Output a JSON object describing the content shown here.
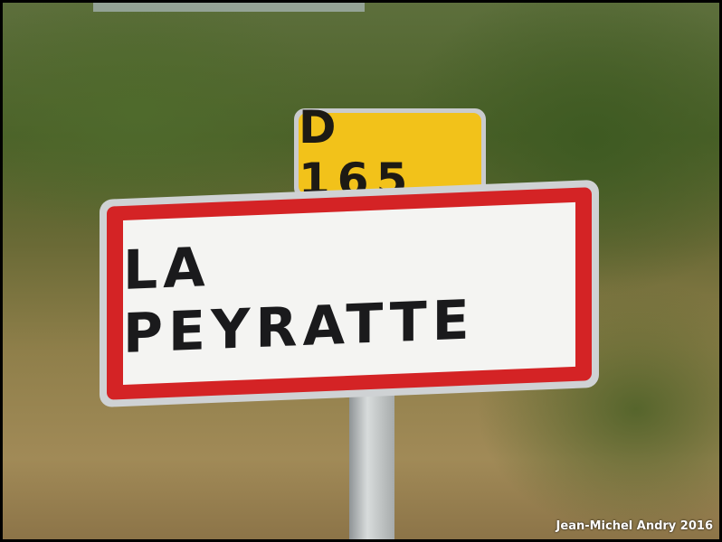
{
  "route_sign": {
    "text": "D 165",
    "color": "#f2c21a"
  },
  "town_sign": {
    "text": "LA PEYRATTE",
    "border_color": "#d42325"
  },
  "credit": "Jean-Michel Andry 2016"
}
